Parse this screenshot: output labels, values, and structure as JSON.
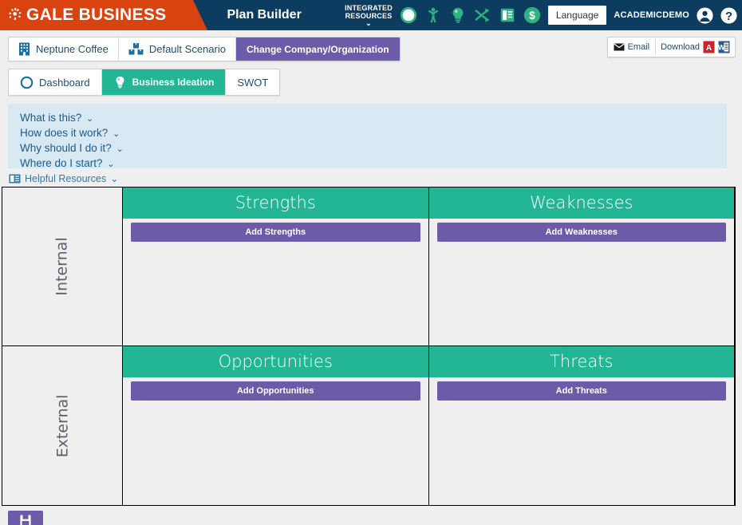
{
  "header": {
    "brand": "GALE BUSINESS",
    "brand_logo_icon": "gale-burst-logo",
    "app_title": "Plan Builder",
    "integrated_resources_line1": "INTEGRATED",
    "integrated_resources_line2": "RESOURCES",
    "integrated_resources_chevron": "⌄",
    "resource_icons": [
      {
        "name": "compass-icon"
      },
      {
        "name": "person-icon"
      },
      {
        "name": "lightbulb-icon"
      },
      {
        "name": "shuffle-icon"
      },
      {
        "name": "book-icon"
      },
      {
        "name": "dollar-icon"
      }
    ],
    "language_label": "Language",
    "account_name": "ACADEMICDEMO",
    "user_icon": "user-avatar-icon",
    "help_icon": "question-mark-icon",
    "brand_color": "#d9430f",
    "bar_color": "#0d3c61",
    "icon_color": "#2cb37f"
  },
  "breadcrumb": {
    "company": "Neptune Coffee",
    "company_icon": "building-icon",
    "scenario": "Default Scenario",
    "scenario_icon": "boxes-icon",
    "change_action": "Change Company/Organization"
  },
  "export": {
    "email_label": "Email",
    "email_icon": "envelope-icon",
    "download_label": "Download",
    "pdf_icon": "pdf-file-icon",
    "word_icon": "word-file-icon"
  },
  "tabs": [
    {
      "label": "Dashboard",
      "icon": "compass-icon",
      "active": false
    },
    {
      "label": "Business Ideation",
      "icon": "lightbulb-icon",
      "active": true
    },
    {
      "label": "SWOT",
      "icon": "none",
      "active": false
    }
  ],
  "info_panel": {
    "links": [
      {
        "label": "What is this?"
      },
      {
        "label": "How does it work?"
      },
      {
        "label": "Why should I do it?"
      },
      {
        "label": "Where do I start?"
      }
    ],
    "chevron": "⌄",
    "background": "#d8e9f3"
  },
  "resources": {
    "label": "Helpful Resources",
    "icon": "resource-card-icon",
    "chevron": "⌄"
  },
  "swot": {
    "header_color": "#22b694",
    "button_color": "#6b5ba8",
    "rows": [
      {
        "axis": "Internal",
        "quadrants": [
          {
            "title": "Strengths",
            "add_label": "Add Strengths"
          },
          {
            "title": "Weaknesses",
            "add_label": "Add Weaknesses"
          }
        ]
      },
      {
        "axis": "External",
        "quadrants": [
          {
            "title": "Opportunities",
            "add_label": "Add Opportunities"
          },
          {
            "title": "Threats",
            "add_label": "Add Threats"
          }
        ]
      }
    ]
  },
  "footer": {
    "action_icon": "save-icon"
  }
}
